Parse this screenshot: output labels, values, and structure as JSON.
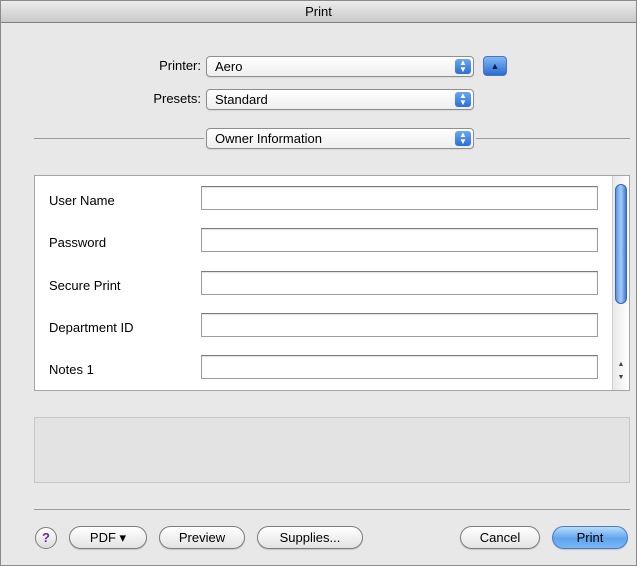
{
  "window": {
    "title": "Print"
  },
  "printer": {
    "label": "Printer:",
    "value": "Aero"
  },
  "presets": {
    "label": "Presets:",
    "value": "Standard"
  },
  "section": {
    "value": "Owner Information"
  },
  "fields": [
    {
      "label": "User Name",
      "value": ""
    },
    {
      "label": "Password",
      "value": ""
    },
    {
      "label": "Secure Print",
      "value": ""
    },
    {
      "label": "Department ID",
      "value": ""
    },
    {
      "label": "Notes 1",
      "value": ""
    }
  ],
  "buttons": {
    "help": "?",
    "pdf": "PDF ▾",
    "preview": "Preview",
    "supplies": "Supplies...",
    "cancel": "Cancel",
    "print": "Print"
  },
  "icons": {
    "popup_arrows": "updown-arrows-icon",
    "disclosure": "disclosure-triangle-icon"
  },
  "colors": {
    "accent": "#2c6fd6",
    "window_bg": "#e8e8e8"
  }
}
